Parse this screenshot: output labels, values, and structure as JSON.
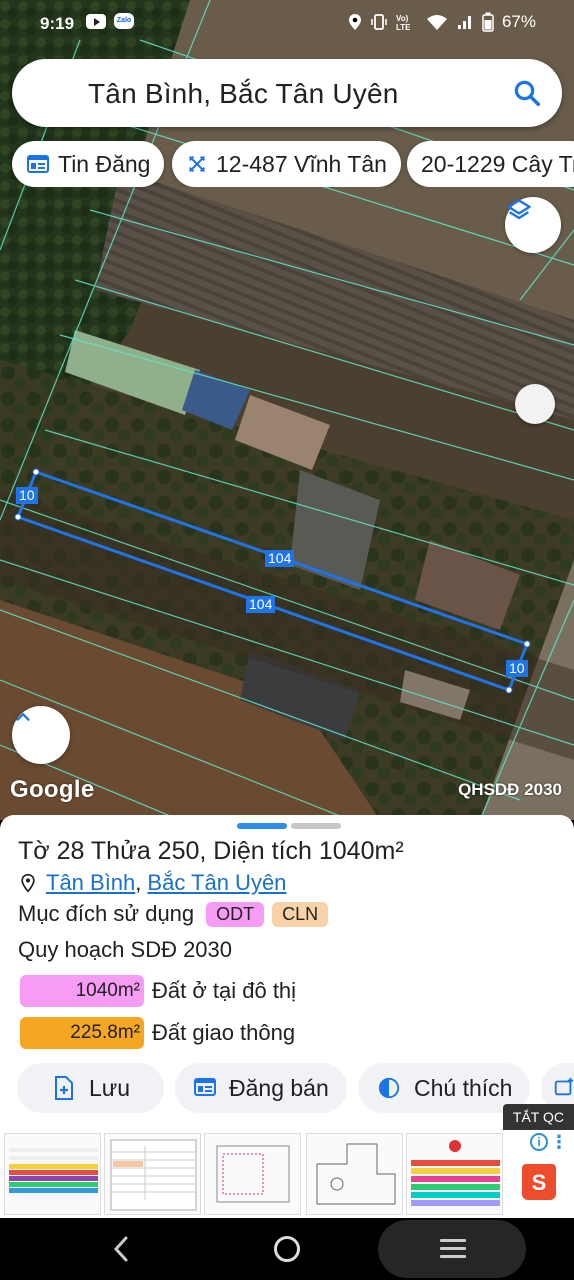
{
  "status_bar": {
    "time": "9:19",
    "zalo": "Zalo",
    "battery": "67%"
  },
  "search": {
    "query": "Tân Bình, Bắc Tân Uyên"
  },
  "chips": [
    {
      "label": "Tin Đăng",
      "icon": "listing-icon"
    },
    {
      "label": "12-487 Vĩnh Tân",
      "icon": "measure-icon"
    },
    {
      "label": "20-1229 Cây Tr",
      "icon": ""
    }
  ],
  "map": {
    "dimensions": [
      "10",
      "104",
      "104",
      "10"
    ],
    "google_logo": "Google",
    "plan_label": "QHSDĐ 2030"
  },
  "parcel": {
    "title": "Tờ 28 Thửa 250, Diện tích 1040m²",
    "location_ward": "Tân Bình",
    "location_sep": ",",
    "location_district": "Bắc Tân Uyên",
    "purpose_label": "Mục đích sử dụng",
    "purpose_badges": [
      "ODT",
      "CLN"
    ],
    "plan_title": "Quy hoạch SDĐ 2030",
    "plan_items": [
      {
        "area": "1040m²",
        "label": "Đất ở tại đô thị",
        "color": "#f79cf5"
      },
      {
        "area": "225.8m²",
        "label": "Đất giao thông",
        "color": "#f5a623"
      }
    ]
  },
  "actions": [
    {
      "label": "Lưu",
      "icon": "add-file-icon"
    },
    {
      "label": "Đăng bán",
      "icon": "listing-icon"
    },
    {
      "label": "Chú thích",
      "icon": "contrast-icon"
    }
  ],
  "ad": {
    "close_label": "TẮT QC",
    "info": "i",
    "shop_logo": "S"
  },
  "colors": {
    "accent": "#1e74e8",
    "link": "#1a6fcf",
    "odt": "#f79cf5",
    "cln": "#f8d3a8",
    "traffic": "#f5a623"
  }
}
